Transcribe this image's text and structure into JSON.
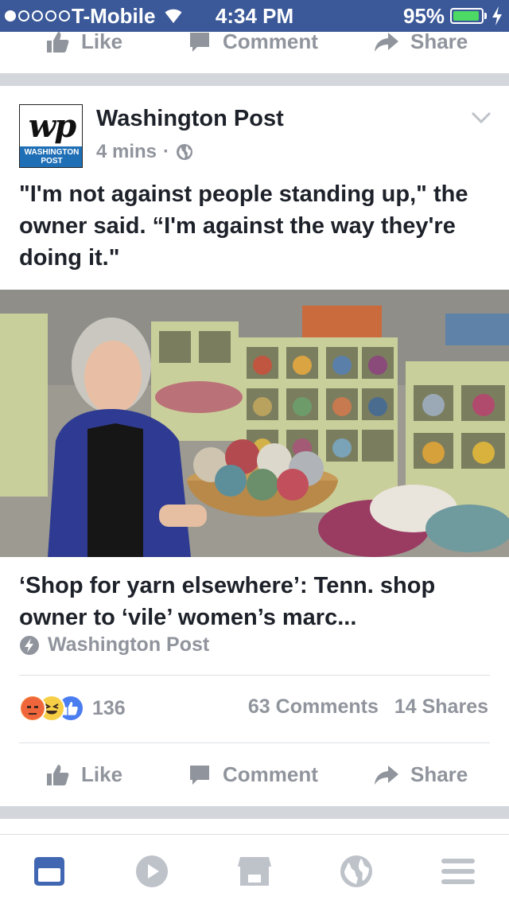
{
  "status_bar": {
    "carrier": "T-Mobile",
    "time": "4:34 PM",
    "battery_percent": "95%",
    "battery_level": 0.95,
    "signal_bars_filled": 1,
    "signal_bars_total": 5
  },
  "top_actions": {
    "like_label": "Like",
    "comment_label": "Comment",
    "share_label": "Share"
  },
  "post": {
    "page_name": "Washington Post",
    "logo_text": "WASHINGTON POST",
    "logo_mark": "wp",
    "timestamp": "4 mins",
    "separator": "·",
    "privacy_icon": "globe-icon",
    "text": "\"I'm not against people standing up,\" the owner said. “I'm against the way they're doing it.\"",
    "link": {
      "title": "‘Shop for yarn elsewhere’: Tenn. shop owner to ‘vile’ women’s marc...",
      "source": "Washington Post",
      "source_icon": "verified-bolt-icon"
    },
    "reactions": [
      "angry",
      "haha",
      "like"
    ],
    "reaction_count": "136",
    "comments": "63 Comments",
    "shares": "14 Shares",
    "actions": {
      "like_label": "Like",
      "comment_label": "Comment",
      "share_label": "Share"
    }
  },
  "tab_bar": {
    "tabs": [
      {
        "name": "news-feed",
        "icon": "news-feed-icon",
        "active": true
      },
      {
        "name": "video",
        "icon": "play-icon",
        "active": false
      },
      {
        "name": "marketplace",
        "icon": "marketplace-icon",
        "active": false
      },
      {
        "name": "notifications",
        "icon": "globe-icon",
        "active": false
      },
      {
        "name": "menu",
        "icon": "hamburger-icon",
        "active": false
      }
    ]
  },
  "colors": {
    "brand_blue": "#3b5998",
    "active_tab": "#4267b2",
    "muted_text": "#90949c",
    "body_text": "#1d2129",
    "logo_band": "#1f6fb6"
  }
}
